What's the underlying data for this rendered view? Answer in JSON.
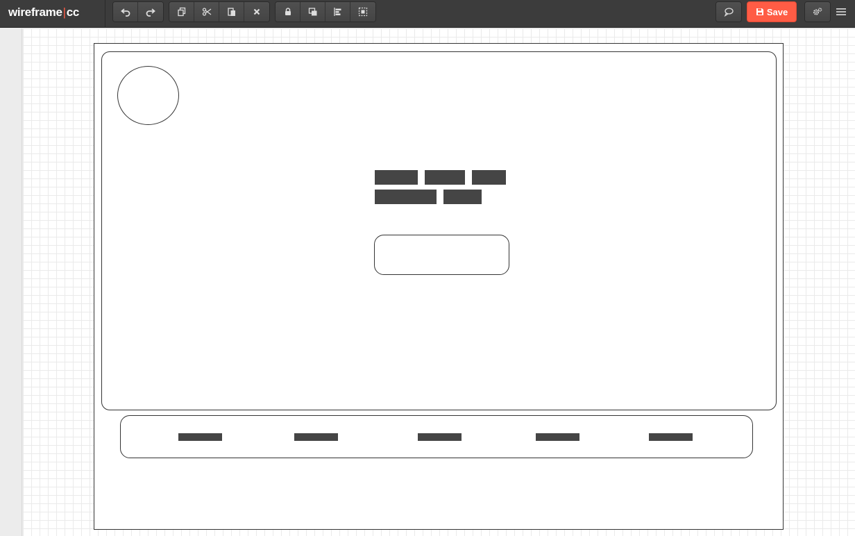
{
  "app": {
    "logo_left": "wireframe",
    "logo_sep": "|",
    "logo_right": "cc"
  },
  "toolbar": {
    "history": [
      {
        "icon": "undo-icon"
      },
      {
        "icon": "redo-icon"
      }
    ],
    "edit": [
      {
        "icon": "copy-icon"
      },
      {
        "icon": "cut-icon"
      },
      {
        "icon": "paste-icon"
      },
      {
        "icon": "delete-icon"
      }
    ],
    "arrange": [
      {
        "icon": "lock-icon"
      },
      {
        "icon": "bring-to-front-icon"
      },
      {
        "icon": "align-icon"
      },
      {
        "icon": "group-icon"
      }
    ],
    "comment_icon": "comment-icon",
    "save_label": "Save",
    "save_color": "#ff5c45",
    "settings_icon": "settings-icon",
    "menu_icon": "hamburger-menu-icon"
  },
  "wireframe": {
    "text_placeholder_rows": 2,
    "nav_items_count": 5,
    "placeholder_color": "#454545"
  }
}
